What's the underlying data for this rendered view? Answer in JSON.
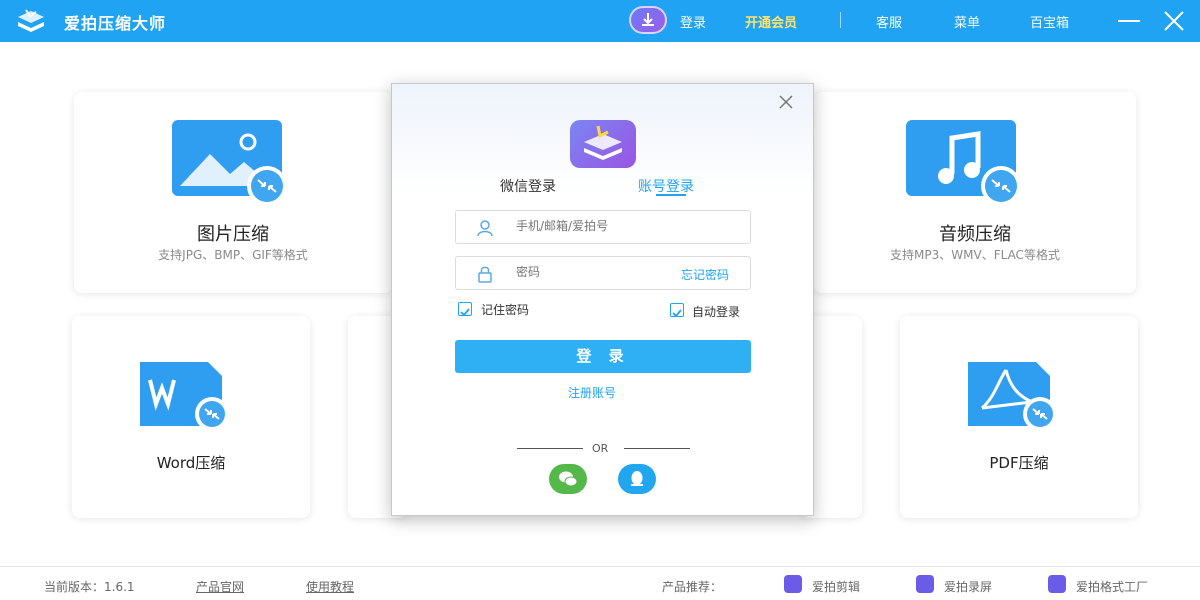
{
  "app": {
    "title": "爱拍压缩大师"
  },
  "nav": {
    "login": "登录",
    "vip": "开通会员",
    "service": "客服",
    "menu": "菜单",
    "toolbox": "百宝箱"
  },
  "cards": {
    "image": {
      "title": "图片压缩",
      "desc": "支持JPG、BMP、GIF等格式"
    },
    "audio": {
      "title": "音频压缩",
      "desc": "支持MP3、WMV、FLAC等格式"
    },
    "word": {
      "title": "Word压缩"
    },
    "pdf": {
      "title": "PDF压缩"
    }
  },
  "dialog": {
    "tab_wechat": "微信登录",
    "tab_account": "账号登录",
    "user_placeholder": "手机/邮箱/爱拍号",
    "pass_placeholder": "密码",
    "forgot": "忘记密码",
    "remember": "记住密码",
    "auto_login": "自动登录",
    "login_button": "登 录",
    "register": "注册账号",
    "or": "OR"
  },
  "footer": {
    "version": "当前版本：1.6.1",
    "website": "产品官网",
    "tutorial": "使用教程",
    "recommend": "产品推荐：",
    "app1": "爱拍剪辑",
    "app2": "爱拍录屏",
    "app3": "爱拍格式工厂"
  },
  "colors": {
    "accent": "#1fa3f2",
    "vip": "#ffe36b",
    "wechat": "#55b84a",
    "qq": "#23a6f0"
  }
}
